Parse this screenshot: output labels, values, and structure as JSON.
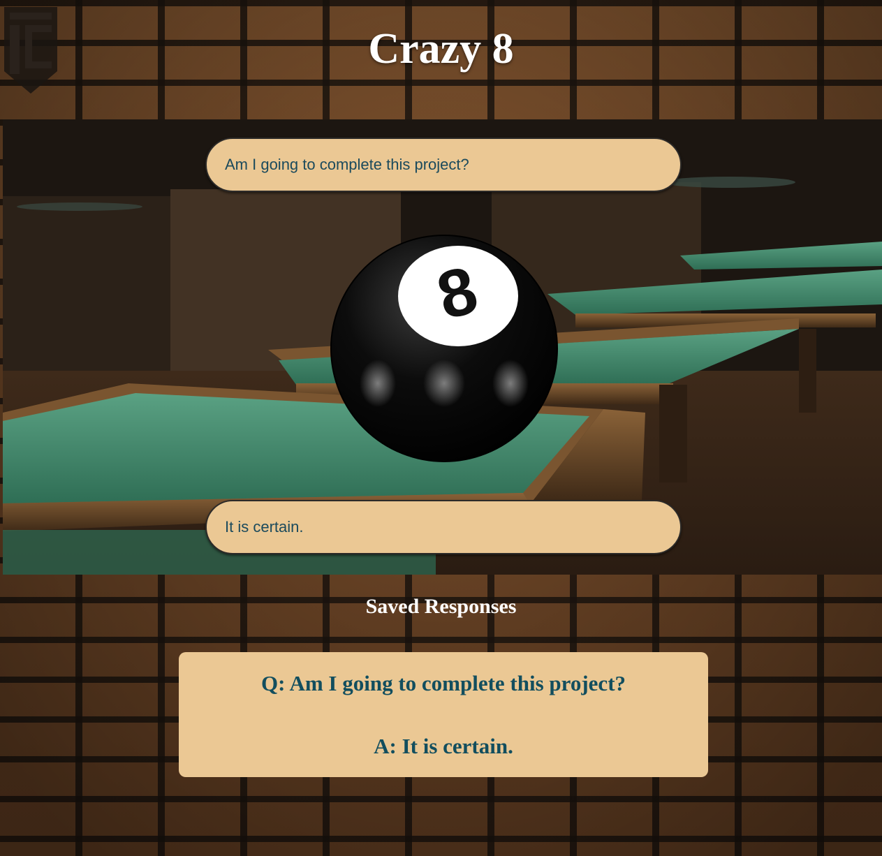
{
  "app": {
    "title": "Crazy 8",
    "logo_icon": "tc-shield-logo-icon"
  },
  "question_input": {
    "value": "Am I going to complete this project?"
  },
  "magic_ball": {
    "icon": "eight-ball-icon",
    "number": "8"
  },
  "answer_display": {
    "value": "It is certain."
  },
  "saved": {
    "heading": "Saved Responses",
    "items": [
      {
        "question": "Q: Am I going to complete this project?",
        "answer": "A: It is certain."
      }
    ]
  },
  "colors": {
    "pill_background": "#ebc894",
    "pill_text": "#1b4a5c",
    "card_text": "#124e5e",
    "title_text": "#ffffff"
  }
}
